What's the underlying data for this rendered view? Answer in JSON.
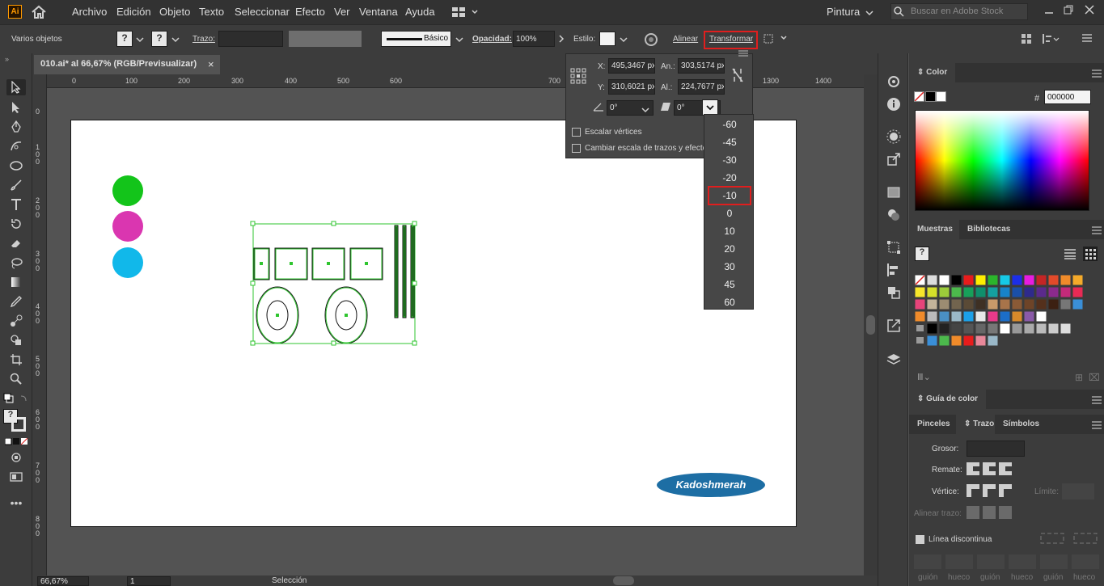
{
  "menubar": {
    "app_logo": "Ai",
    "items": [
      "Archivo",
      "Edición",
      "Objeto",
      "Texto",
      "Seleccionar",
      "Efecto",
      "Ver",
      "Ventana",
      "Ayuda"
    ],
    "workspace": "Pintura",
    "search_placeholder": "Buscar en Adobe Stock"
  },
  "control": {
    "selection_label": "Varios objetos",
    "stroke_label": "Trazo:",
    "stroke_style": "Básico",
    "opacity_label": "Opacidad:",
    "opacity_value": "100%",
    "style_label": "Estilo:",
    "align": "Alinear",
    "transform": "Transformar"
  },
  "document": {
    "tab_title": "010.ai* al 66,67% (RGB/Previsualizar)",
    "close": "×"
  },
  "rulers": {
    "h_ticks": [
      "0",
      "100",
      "200",
      "300",
      "400",
      "500",
      "600",
      "700",
      "1300",
      "1400"
    ],
    "v_ticks": [
      "0",
      "1\n0\n0",
      "2\n0\n0",
      "3\n0\n0",
      "4\n0\n0",
      "5\n0\n0",
      "6\n0\n0",
      "7\n0\n0",
      "8\n0\n0"
    ]
  },
  "status": {
    "zoom": "66,67%",
    "page": "1",
    "tool": "Selección"
  },
  "transform_panel": {
    "x_label": "X:",
    "x_value": "495,3467 px",
    "y_label": "Y:",
    "y_value": "310,6021 px",
    "w_label": "An.:",
    "w_value": "303,5174 px",
    "h_label": "Al.:",
    "h_value": "224,7677 px",
    "rotate_value": "0°",
    "shear_value": "0°",
    "scale_corners": "Escalar vértices",
    "scale_strokes": "Cambiar escala de trazos y efectos"
  },
  "shear_dropdown": {
    "options": [
      "-60",
      "-45",
      "-30",
      "-20",
      "-10",
      "0",
      "10",
      "20",
      "30",
      "45",
      "60"
    ],
    "highlighted": "-10"
  },
  "color_panel": {
    "title": "Color",
    "hex_label": "#",
    "hex_value": "000000"
  },
  "swatches_panel": {
    "tabs": [
      "Muestras",
      "Bibliotecas"
    ]
  },
  "color_guide": {
    "title": "Guía de color"
  },
  "stroke_panel": {
    "tabs": [
      "Pinceles",
      "Trazo",
      "Símbolos"
    ],
    "weight_label": "Grosor:",
    "cap_label": "Remate:",
    "corner_label": "Vértice:",
    "limit_label": "Límite:",
    "align_label": "Alinear trazo:",
    "dashed_label": "Línea discontinua",
    "dash_labels": [
      "guión",
      "hueco",
      "guión",
      "hueco",
      "guión",
      "hueco"
    ]
  },
  "artwork": {
    "logo_text": "Kadoshmerah",
    "circle_colors": [
      "#13c41a",
      "#da36b0",
      "#11b8ea"
    ]
  },
  "colors": {
    "accent": "#e01e1e",
    "selection": "#2fc52f",
    "logo_bg": "#1d6ea4"
  }
}
